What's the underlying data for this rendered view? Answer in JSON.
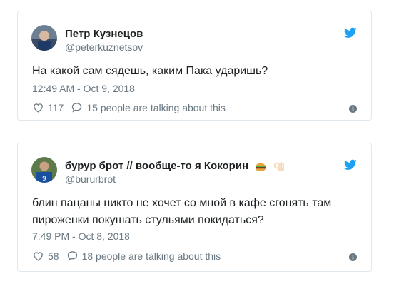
{
  "tweets": [
    {
      "name": "Петр Кузнецов",
      "handle": "@peterkuznetsov",
      "text": "На какой сам сядешь, каким Пака ударишь?",
      "time": "12:49 AM - Oct 9, 2018",
      "likes": "117",
      "talking": "15 people are talking about this"
    },
    {
      "name": "бурур брот // вообще-то я Кокорин",
      "handle": "@bururbrot",
      "text": "блин пацаны никто не хочет со мной в кафе сгонять там пироженки покушать стульями покидаться?",
      "time": "7:49 PM - Oct 8, 2018",
      "likes": "58",
      "talking": "18 people are talking about this",
      "name_emojis": [
        "burger-emoji",
        "ok-hand-emoji"
      ]
    }
  ],
  "colors": {
    "twitter_blue": "#1da1f2",
    "meta_gray": "#697882",
    "border": "#e1e8ed"
  },
  "icons": [
    "twitter-bird-icon",
    "heart-icon",
    "reply-icon",
    "info-icon"
  ]
}
